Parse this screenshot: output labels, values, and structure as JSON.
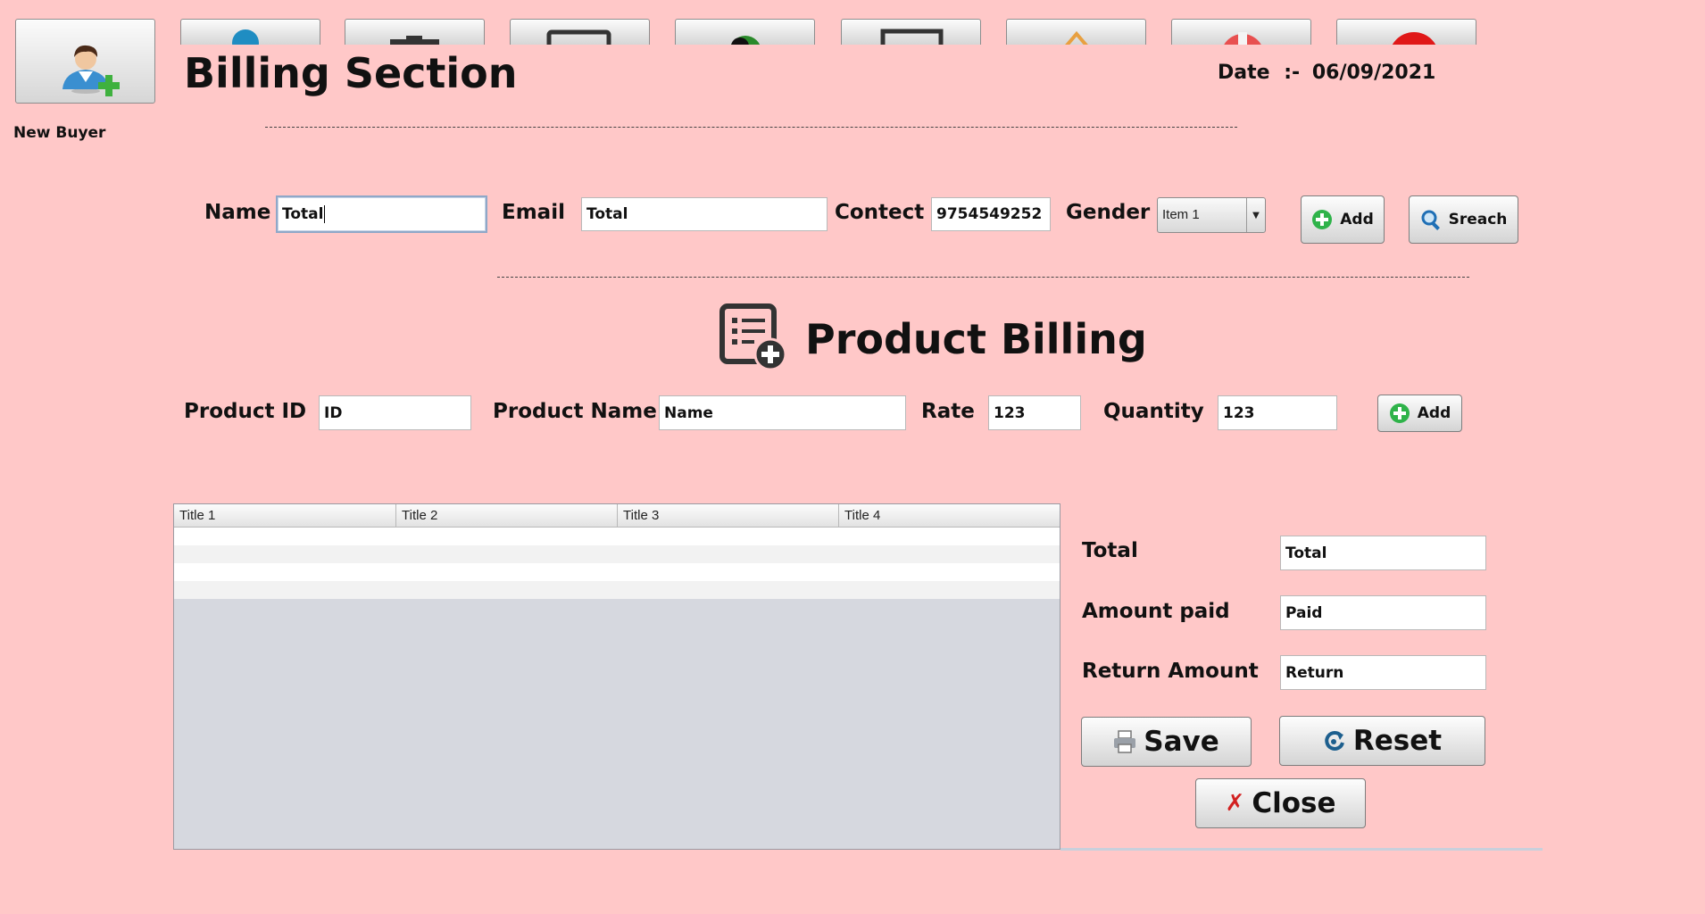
{
  "header": {
    "new_buyer_label": "New Buyer",
    "title": "Billing Section",
    "date_label": "Date",
    "date_sep": ":-",
    "date_value": "06/09/2021"
  },
  "buyer_form": {
    "name_label": "Name",
    "name_value": "Total",
    "email_label": "Email",
    "email_value": "Total",
    "contact_label": "Contect",
    "contact_value": "9754549252",
    "gender_label": "Gender",
    "gender_value": "Item 1",
    "add_label": "Add",
    "search_label": "Sreach"
  },
  "product_section": {
    "title": "Product Billing",
    "product_id_label": "Product ID",
    "product_id_value": "ID",
    "product_name_label": "Product Name",
    "product_name_value": "Name",
    "rate_label": "Rate",
    "rate_value": "123",
    "quantity_label": "Quantity",
    "quantity_value": "123",
    "add_label": "Add"
  },
  "table": {
    "columns": [
      "Title 1",
      "Title 2",
      "Title 3",
      "Title 4"
    ]
  },
  "summary": {
    "total_label": "Total",
    "total_value": "Total",
    "amount_paid_label": "Amount paid",
    "amount_paid_value": "Paid",
    "return_label": "Return Amount",
    "return_value": "Return"
  },
  "actions": {
    "save_label": "Save",
    "reset_label": "Reset",
    "close_label": "Close"
  },
  "colors": {
    "background": "#ffc8c8",
    "add_icon": "#2fb34a",
    "close_icon": "#d22020"
  }
}
